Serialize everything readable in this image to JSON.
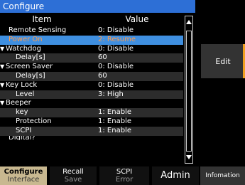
{
  "title": "Configure",
  "headers": {
    "item": "Item",
    "value": "Value"
  },
  "rows": [
    {
      "item": "Remote Sensing",
      "value": "0: Disable",
      "level": 0
    },
    {
      "item": "Power On",
      "value": "2: Resume",
      "level": 0,
      "selected": true
    },
    {
      "item": "Watchdog",
      "value": "0: Disable",
      "level": 0,
      "expanded": true
    },
    {
      "item": "Delay[s]",
      "value": "60",
      "level": 2
    },
    {
      "item": "Screen Saver",
      "value": "0: Disable",
      "level": 0,
      "expanded": true
    },
    {
      "item": "Delay[s]",
      "value": "60",
      "level": 2
    },
    {
      "item": "Key Lock",
      "value": "0: Disable",
      "level": 0,
      "expanded": true
    },
    {
      "item": "Level",
      "value": "3: High",
      "level": 2
    },
    {
      "item": "Beeper",
      "value": "",
      "level": 0,
      "expanded": true
    },
    {
      "item": "key",
      "value": "1: Enable",
      "level": 2
    },
    {
      "item": "Protection",
      "value": "1: Enable",
      "level": 2
    },
    {
      "item": "SCPI",
      "value": "1: Enable",
      "level": 2
    },
    {
      "item": "Digital?",
      "value": "",
      "level": 0
    }
  ],
  "side": {
    "edit_label": "Edit"
  },
  "softkeys": {
    "configure": {
      "line1": "Configure",
      "line2": "Interface"
    },
    "recall": {
      "line1": "Recall",
      "line2": "Save"
    },
    "scpi": {
      "line1": "SCPI",
      "line2": "Error"
    },
    "admin": {
      "label": "Admin"
    },
    "info": {
      "label": "Infomation"
    }
  },
  "colors": {
    "title_bg": "#2d6fd6",
    "selected_bg": "#3f8fe0",
    "selected_text": "#ff9a4a",
    "accent": "#f0a020"
  }
}
